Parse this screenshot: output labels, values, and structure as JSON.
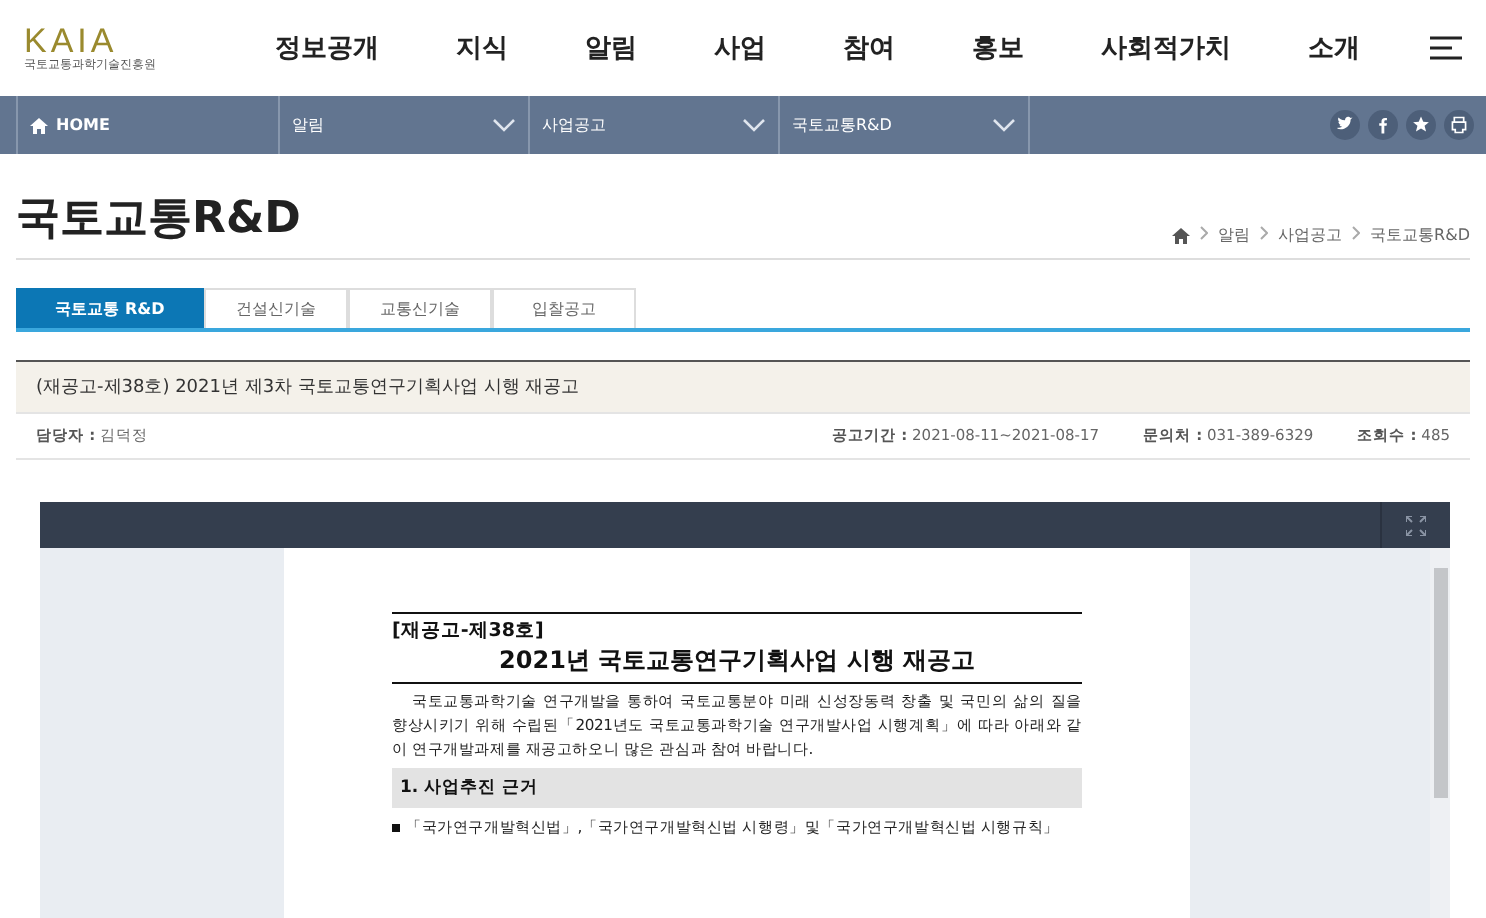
{
  "header": {
    "logo_text": "KAIA",
    "logo_subtitle": "국토교통과학기술진흥원",
    "menu": [
      "정보공개",
      "지식",
      "알림",
      "사업",
      "참여",
      "홍보",
      "사회적가치",
      "소개"
    ]
  },
  "location_bar": {
    "home": "HOME",
    "dropdowns": [
      "알림",
      "사업공고",
      "국토교통R&D"
    ]
  },
  "page_title": "국토교통R&D",
  "breadcrumb": [
    "알림",
    "사업공고",
    "국토교통R&D"
  ],
  "tabs": [
    {
      "label": "국토교통 R&D",
      "selected": true
    },
    {
      "label": "건설신기술",
      "selected": false
    },
    {
      "label": "교통신기술",
      "selected": false
    },
    {
      "label": "입찰공고",
      "selected": false
    }
  ],
  "notice": {
    "title": "(재공고-제38호) 2021년 제3차 국토교통연구기획사업 시행 재공고",
    "meta": [
      {
        "label": "담당자 :",
        "value": "김덕정"
      },
      {
        "label": "공고기간 :",
        "value": "2021-08-11~2021-08-17"
      },
      {
        "label": "문의처 :",
        "value": "031-389-6329"
      },
      {
        "label": "조회수 :",
        "value": "485"
      }
    ]
  },
  "document": {
    "number": "[재공고-제38호]",
    "heading": "2021년 국토교통연구기획사업 시행 재공고",
    "intro": "국토교통과학기술 연구개발을 통하여 국토교통분야 미래 신성장동력 창출 및 국민의 삶의 질을 향상시키기 위해 수립된「2021년도 국토교통과학기술 연구개발사업 시행계획」에 따라 아래와 같이 연구개발과제를 재공고하오니 많은 관심과 참여 바랍니다.",
    "section": "1. 사업추진 근거",
    "bullets": [
      "「국가연구개발혁신법」,「국가연구개발혁신법 시행령」및「국가연구개발혁신법 시행규칙」"
    ]
  }
}
